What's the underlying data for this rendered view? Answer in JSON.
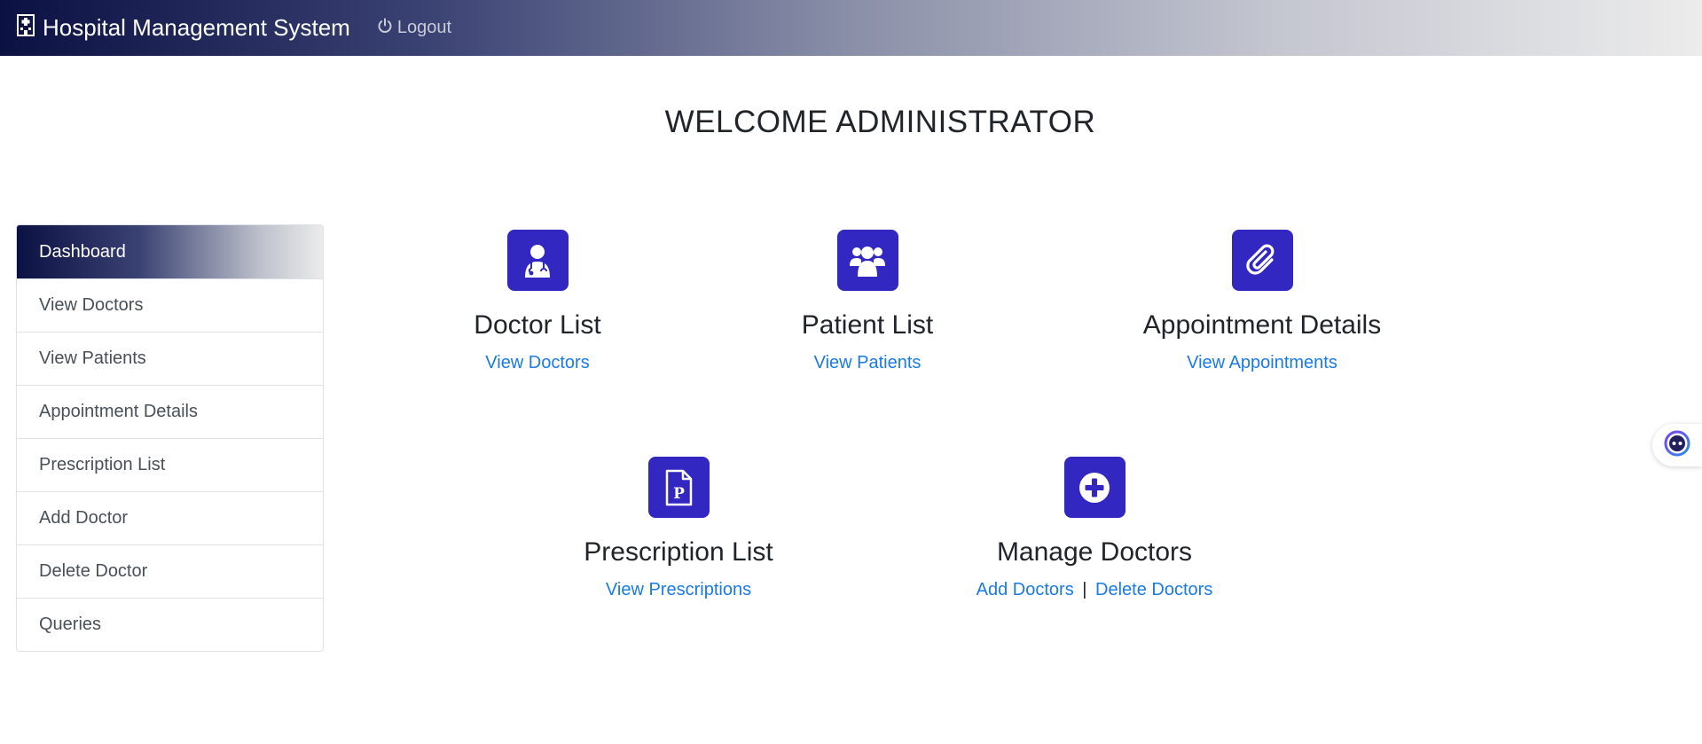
{
  "app": {
    "title": "Hospital Management System",
    "logout_label": "Logout"
  },
  "welcome": "WELCOME ADMINISTRATOR",
  "sidebar": {
    "items": [
      {
        "label": "Dashboard",
        "active": true
      },
      {
        "label": "View Doctors"
      },
      {
        "label": "View Patients"
      },
      {
        "label": "Appointment Details"
      },
      {
        "label": "Prescription List"
      },
      {
        "label": "Add Doctor"
      },
      {
        "label": "Delete Doctor"
      },
      {
        "label": "Queries"
      }
    ]
  },
  "cards": {
    "doctors": {
      "title": "Doctor List",
      "icon": "doctor-icon",
      "link": "View Doctors"
    },
    "patients": {
      "title": "Patient List",
      "icon": "users-icon",
      "link": "View Patients"
    },
    "appointments": {
      "title": "Appointment Details",
      "icon": "paperclip-icon",
      "link": "View Appointments"
    },
    "prescriptions": {
      "title": "Prescription List",
      "icon": "prescription-icon",
      "link": "View Prescriptions"
    },
    "manage": {
      "title": "Manage Doctors",
      "icon": "plus-circle-icon",
      "link_add": "Add Doctors",
      "separator": "|",
      "link_delete": "Delete Doctors"
    }
  },
  "colors": {
    "accent": "#3327c2",
    "link": "#1a7ae8",
    "navbar_start": "#0b1142",
    "navbar_end": "#ececec"
  }
}
